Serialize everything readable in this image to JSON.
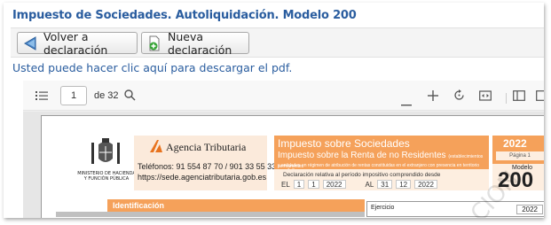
{
  "page": {
    "title": "Impuesto de Sociedades. Autoliquidación. Modelo 200",
    "download_link": "Usted puede hacer clic aquí para descargar el pdf."
  },
  "buttons": {
    "back": "Volver a declaración",
    "new": "Nueva declaración"
  },
  "viewer": {
    "page_number": "1",
    "page_total": "de 32",
    "icons": [
      "sidebar-toggle-icon",
      "search-icon",
      "zoom-out-icon",
      "zoom-in-icon",
      "rotate-icon",
      "fit-width-icon",
      "view-mode-icon",
      "page-view-icon"
    ]
  },
  "document": {
    "ministry": "MINISTERIO DE HACIENDA Y FUNCIÓN PÚBLICA",
    "agency": "Agencia Tributaria",
    "phones": "Teléfonos: 91 554 87 70 / 901 33 55 33",
    "url": "https://sede.agenciatributaria.gob.es",
    "tax_title": "Impuesto sobre Sociedades",
    "tax_subtitle": "Impuesto sobre la Renta de no Residentes",
    "tax_subtitle_note": "(establecimientos permanentes",
    "tax_note": "y entidades en régimen de atribución de rentas constituidas en el extranjero con presencia en territorio español)",
    "period_label": "Declaración relativa al período impositivo comprendido desde",
    "from_label": "EL",
    "from_day": "1",
    "from_month": "1",
    "from_year": "2022",
    "to_label": "AL",
    "to_day": "31",
    "to_month": "12",
    "to_year": "2022",
    "year": "2022",
    "page_label": "Página 1",
    "model_label": "Modelo",
    "model_number": "200",
    "section": "Identificación",
    "fiscal_year_label": "Ejercicio",
    "fiscal_year": "2022",
    "watermark": "CION"
  },
  "colors": {
    "title_blue": "#2a5d9f",
    "orange": "#f5a15a",
    "orange_light": "#fdeee0"
  }
}
